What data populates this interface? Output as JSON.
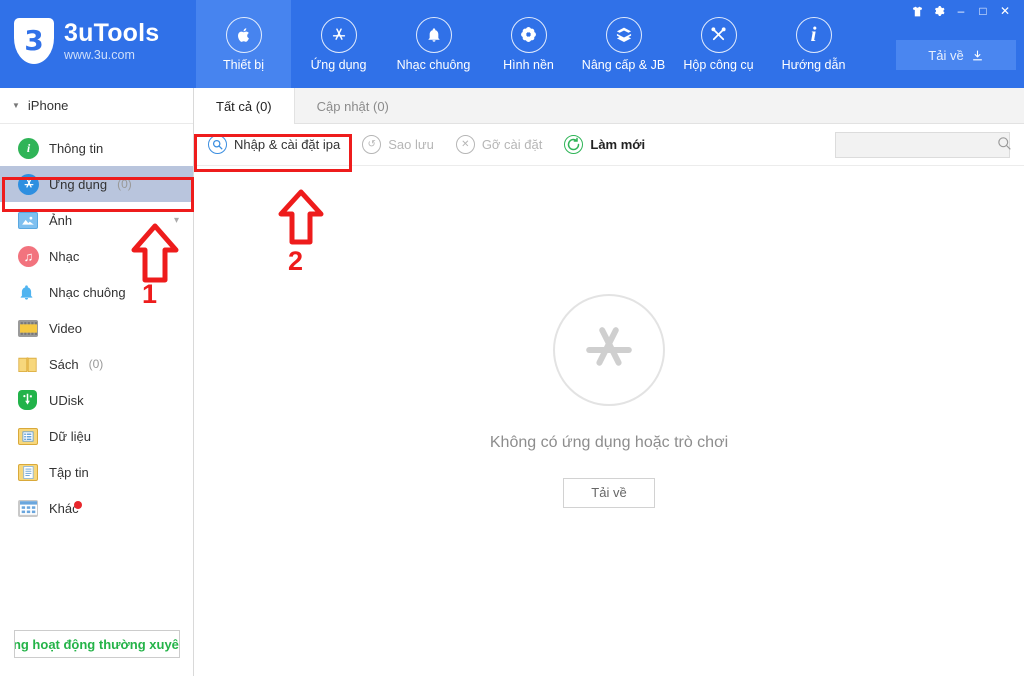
{
  "window": {
    "brand_title": "3uTools",
    "brand_sub": "www.3u.com",
    "controls": [
      {
        "name": "skin-icon",
        "glyph": "\u0001"
      },
      {
        "name": "settings-gear-icon",
        "glyph": "⚙"
      },
      {
        "name": "minimize-button",
        "glyph": "–"
      },
      {
        "name": "maximize-button",
        "glyph": "□"
      },
      {
        "name": "close-button",
        "glyph": "✕"
      }
    ],
    "download_button": "Tải về"
  },
  "nav": {
    "items": [
      {
        "label": "Thiết bị",
        "icon": "apple-icon",
        "active": true
      },
      {
        "label": "Ứng dụng",
        "icon": "appstore-icon",
        "active": false
      },
      {
        "label": "Nhạc chuông",
        "icon": "bell-icon",
        "active": false
      },
      {
        "label": "Hình nền",
        "icon": "flower-icon",
        "active": false
      },
      {
        "label": "Nâng cấp & JB",
        "icon": "box-icon",
        "active": false
      },
      {
        "label": "Hộp công cụ",
        "icon": "tools-icon",
        "active": false
      },
      {
        "label": "Hướng dẫn",
        "icon": "info-icon",
        "active": false
      }
    ]
  },
  "sidebar": {
    "device_name": "iPhone",
    "items": [
      {
        "label": "Thông tin",
        "count": "",
        "icon": "info-circle-icon",
        "selected": false
      },
      {
        "label": "Ứng dụng",
        "count": "(0)",
        "icon": "appstore-circle-icon",
        "selected": true
      },
      {
        "label": "Ảnh",
        "count": "",
        "icon": "photo-icon",
        "selected": false,
        "expandable": true
      },
      {
        "label": "Nhạc",
        "count": "",
        "icon": "music-note-icon",
        "selected": false
      },
      {
        "label": "Nhạc chuông",
        "count": "",
        "icon": "bell-icon",
        "selected": false
      },
      {
        "label": "Video",
        "count": "",
        "icon": "video-icon",
        "selected": false
      },
      {
        "label": "Sách",
        "count": "(0)",
        "icon": "book-icon",
        "selected": false
      },
      {
        "label": "UDisk",
        "count": "",
        "icon": "usb-icon",
        "selected": false
      },
      {
        "label": "Dữ liệu",
        "count": "",
        "icon": "data-icon",
        "selected": false
      },
      {
        "label": "Tập tin",
        "count": "",
        "icon": "file-icon",
        "selected": false
      },
      {
        "label": "Khác",
        "count": "",
        "icon": "other-icon",
        "selected": false,
        "badge": true
      }
    ],
    "status_text": "ông hoạt động thường xuyê"
  },
  "main": {
    "tabs": [
      {
        "label": "Tất cả (0)",
        "active": true
      },
      {
        "label": "Cập nhật (0)",
        "active": false
      }
    ],
    "toolbar": [
      {
        "label": "Nhập & cài đặt ipa",
        "icon": "import-ipa-icon",
        "disabled": false
      },
      {
        "label": "Sao lưu",
        "icon": "backup-icon",
        "disabled": true
      },
      {
        "label": "Gỡ cài đặt",
        "icon": "uninstall-icon",
        "disabled": true
      },
      {
        "label": "Làm mới",
        "icon": "refresh-icon",
        "disabled": false
      }
    ],
    "search_placeholder": "",
    "search_value": "",
    "empty_message": "Không có ứng dụng hoặc trò chơi",
    "empty_button": "Tải về"
  },
  "annotations": {
    "marker_1": "1",
    "marker_2": "2"
  },
  "colors": {
    "header_blue": "#3071e8",
    "nav_active_blue": "#4784ef",
    "selected_row": "#b9c5dd",
    "annotation_red": "#ee1c1c",
    "status_green": "#24b348"
  }
}
